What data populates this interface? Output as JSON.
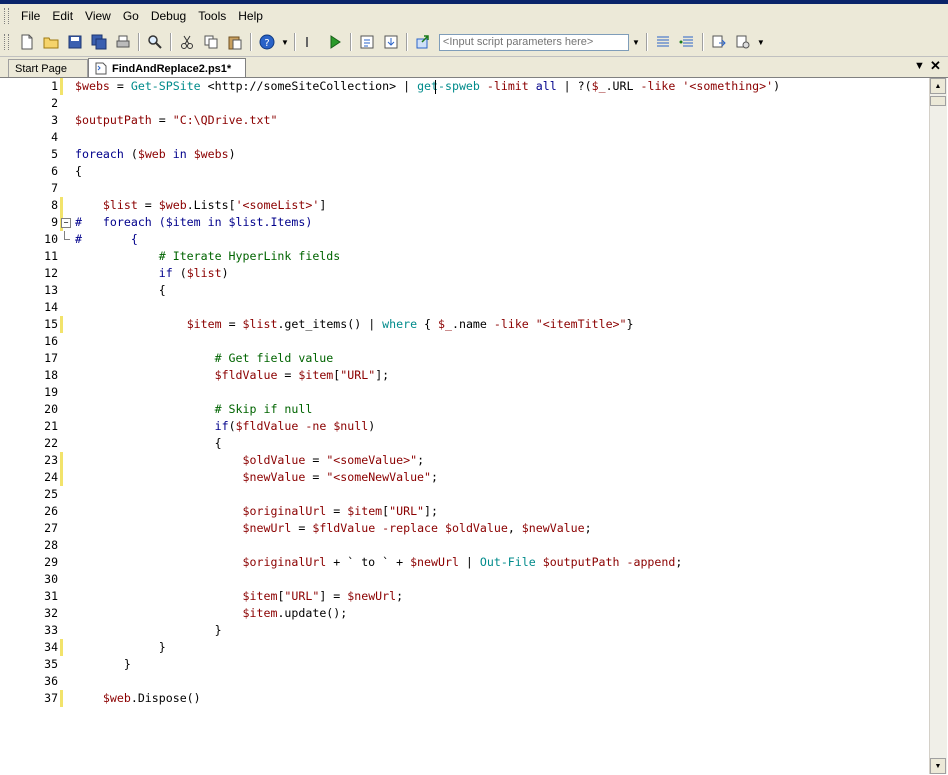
{
  "menu": [
    "File",
    "Edit",
    "View",
    "Go",
    "Debug",
    "Tools",
    "Help"
  ],
  "toolbar": {
    "params_placeholder": "<Input script parameters here>"
  },
  "tabs": [
    {
      "label": "Start Page",
      "active": false
    },
    {
      "label": "FindAndReplace2.ps1*",
      "active": true
    }
  ],
  "colors": {
    "variable": "#8b0000",
    "cmdlet": "#008b8b",
    "keyword": "#00008b",
    "comment": "#006400",
    "string": "#8b0000",
    "modified_marker": "#f2e36b"
  },
  "editor": {
    "lines": [
      {
        "n": "1",
        "text": "$webs = Get-SPSite <http://someSiteCollection> | get-spweb -limit all | ?($_.URL -like '<something>')"
      },
      {
        "n": "2",
        "text": ""
      },
      {
        "n": "3",
        "text": "$outputPath = \"C:\\QDrive.txt\""
      },
      {
        "n": "4",
        "text": ""
      },
      {
        "n": "5",
        "text": "foreach ($web in $webs)"
      },
      {
        "n": "6",
        "text": "{"
      },
      {
        "n": "7",
        "text": ""
      },
      {
        "n": "8",
        "text": "    $list = $web.Lists['<someList>']"
      },
      {
        "n": "9",
        "text": "#   foreach ($item in $list.Items)"
      },
      {
        "n": "10",
        "text": "#       {"
      },
      {
        "n": "11",
        "text": "            # Iterate HyperLink fields"
      },
      {
        "n": "12",
        "text": "            if ($list)"
      },
      {
        "n": "13",
        "text": "            {"
      },
      {
        "n": "14",
        "text": ""
      },
      {
        "n": "15",
        "text": "                $item = $list.get_items() | where { $_.name -like \"<itemTitle>\"}"
      },
      {
        "n": "16",
        "text": ""
      },
      {
        "n": "17",
        "text": "                    # Get field value"
      },
      {
        "n": "18",
        "text": "                    $fldValue = $item[\"URL\"];"
      },
      {
        "n": "19",
        "text": ""
      },
      {
        "n": "20",
        "text": "                    # Skip if null"
      },
      {
        "n": "21",
        "text": "                    if($fldValue -ne $null)"
      },
      {
        "n": "22",
        "text": "                    {"
      },
      {
        "n": "23",
        "text": "                        $oldValue = \"<someValue>\";"
      },
      {
        "n": "24",
        "text": "                        $newValue = \"<someNewValue\";"
      },
      {
        "n": "25",
        "text": ""
      },
      {
        "n": "26",
        "text": "                        $originalUrl = $item[\"URL\"];"
      },
      {
        "n": "27",
        "text": "                        $newUrl = $fldValue -replace $oldValue, $newValue;"
      },
      {
        "n": "28",
        "text": ""
      },
      {
        "n": "29",
        "text": "                        $originalUrl + ` to ` + $newUrl | Out-File $outputPath -append;"
      },
      {
        "n": "30",
        "text": ""
      },
      {
        "n": "31",
        "text": "                        $item[\"URL\"] = $newUrl;"
      },
      {
        "n": "32",
        "text": "                        $item.update();"
      },
      {
        "n": "33",
        "text": "                    }"
      },
      {
        "n": "34",
        "text": "            }"
      },
      {
        "n": "35",
        "text": "       }"
      },
      {
        "n": "36",
        "text": ""
      },
      {
        "n": "37",
        "text": "    $web.Dispose()"
      }
    ],
    "modified_lines": [
      "1",
      "8",
      "9",
      "15",
      "23",
      "24",
      "34",
      "37"
    ]
  }
}
